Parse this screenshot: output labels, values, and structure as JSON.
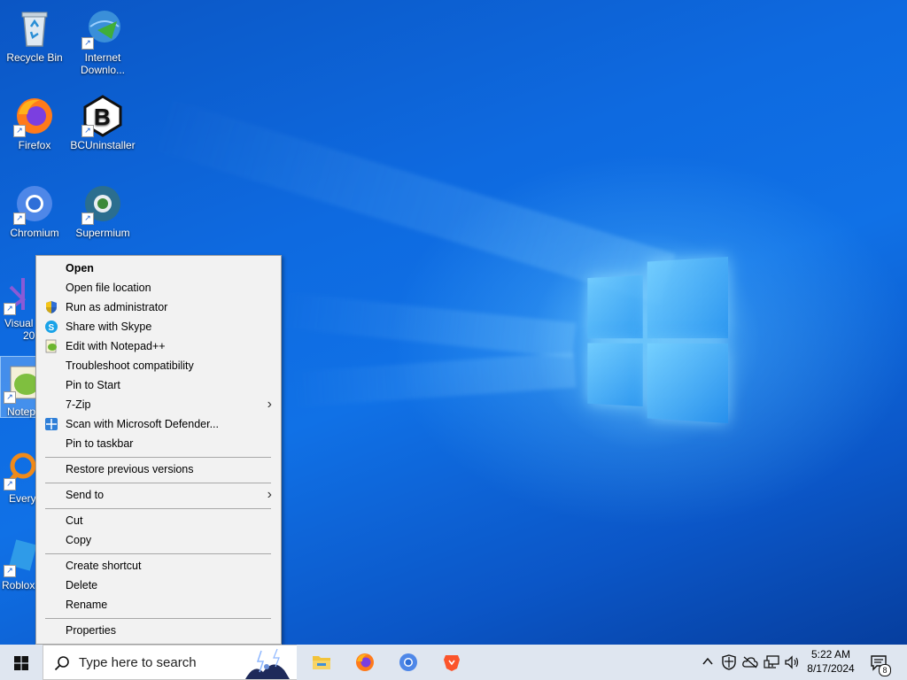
{
  "desktop": {
    "icons": [
      {
        "label": "Recycle Bin"
      },
      {
        "label": "Internet Downlo..."
      },
      {
        "label": "Firefox"
      },
      {
        "label": "BCUninstaller"
      },
      {
        "label": "Chromium"
      },
      {
        "label": "Supermium"
      },
      {
        "label": "Visual"
      },
      {
        "label": "20"
      },
      {
        "label": "Notep"
      },
      {
        "label": "Every"
      },
      {
        "label": "Roblox"
      }
    ]
  },
  "context_menu": {
    "items": [
      {
        "label": "Open"
      },
      {
        "label": "Open file location"
      },
      {
        "label": "Run as administrator"
      },
      {
        "label": "Share with Skype"
      },
      {
        "label": "Edit with Notepad++"
      },
      {
        "label": "Troubleshoot compatibility"
      },
      {
        "label": "Pin to Start"
      },
      {
        "label": "7-Zip"
      },
      {
        "label": "Scan with Microsoft Defender..."
      },
      {
        "label": "Pin to taskbar"
      },
      {
        "label": "Restore previous versions"
      },
      {
        "label": "Send to"
      },
      {
        "label": "Cut"
      },
      {
        "label": "Copy"
      },
      {
        "label": "Create shortcut"
      },
      {
        "label": "Delete"
      },
      {
        "label": "Rename"
      },
      {
        "label": "Properties"
      }
    ]
  },
  "taskbar": {
    "search_placeholder": "Type here to search",
    "time": "5:22 AM",
    "date": "8/17/2024",
    "notification_count": "8"
  }
}
